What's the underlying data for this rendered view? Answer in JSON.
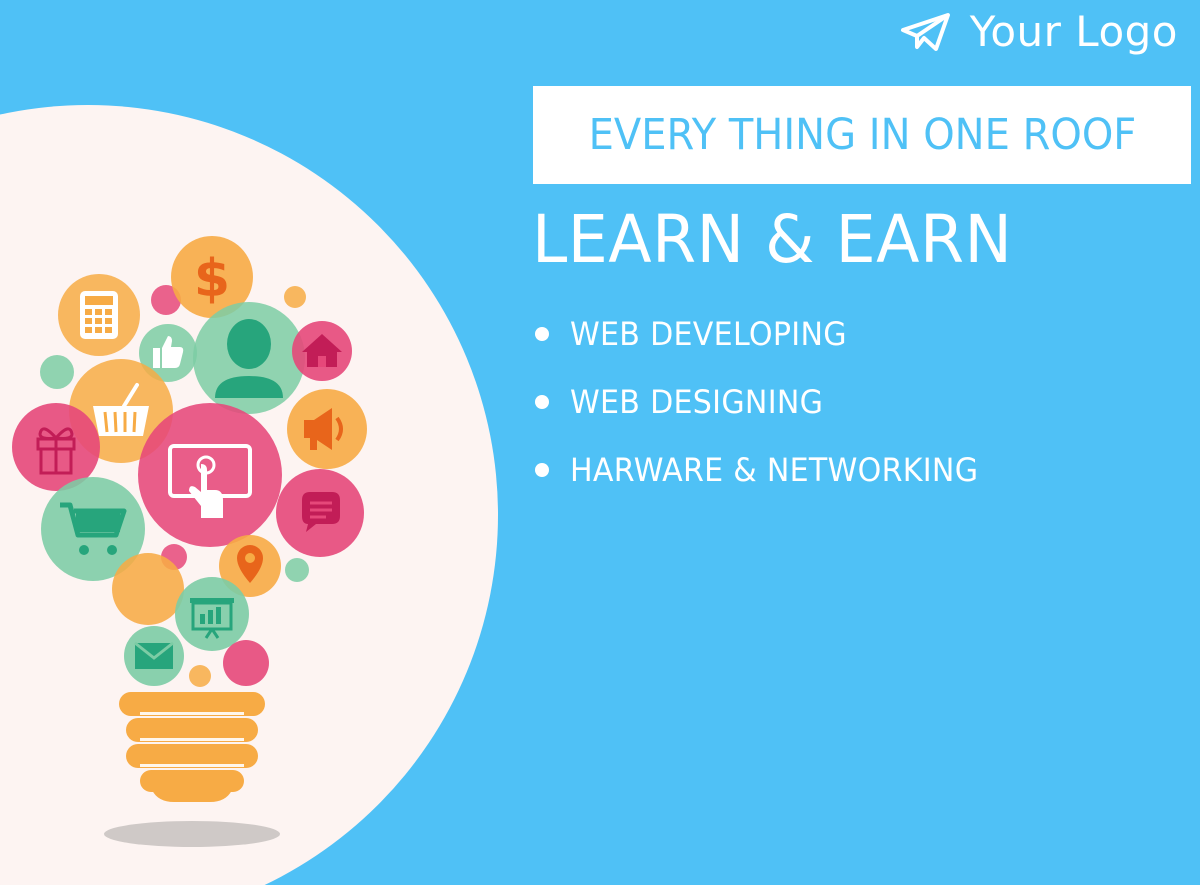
{
  "colors": {
    "background": "#4fc1f6",
    "circle": "#fdf4f2",
    "accent_text": "#4fc1f6",
    "white": "#ffffff",
    "bulb_base": "#f7ab45",
    "pink": "#e6487a",
    "orange": "#f7ab45",
    "green": "#7ccca5",
    "teal_icon": "#27a57c"
  },
  "logo": {
    "icon": "paper-plane-icon",
    "text": "Your Logo"
  },
  "tagline": "EVERY THING IN ONE ROOF",
  "headline": "LEARN & EARN",
  "services": [
    {
      "label": "WEB DEVELOPING"
    },
    {
      "label": "WEB DESIGNING"
    },
    {
      "label": "HARWARE & NETWORKING"
    }
  ],
  "illustration": {
    "icons": [
      "dollar-icon",
      "calculator-icon",
      "thumbs-up-icon",
      "person-icon",
      "home-icon",
      "shopping-basket-icon",
      "gift-icon",
      "megaphone-icon",
      "touch-screen-icon",
      "shopping-cart-icon",
      "chat-bubble-icon",
      "location-pin-icon",
      "presentation-icon",
      "envelope-icon",
      "light-bulb-base-icon"
    ]
  }
}
